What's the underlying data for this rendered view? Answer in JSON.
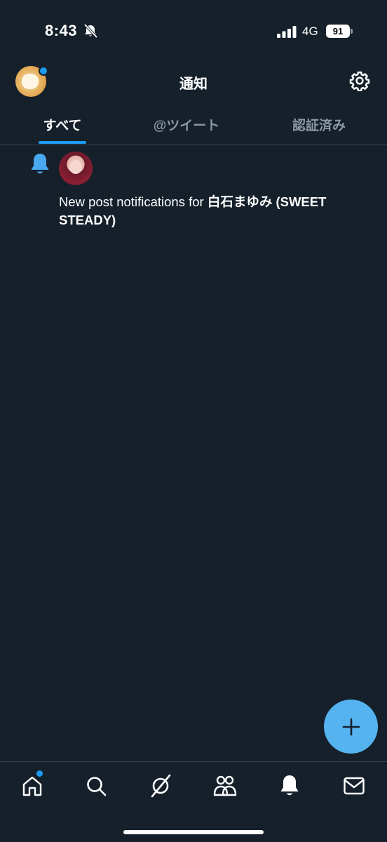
{
  "status_bar": {
    "time": "8:43",
    "network": "4G",
    "battery": "91",
    "icons": [
      "mute-bell-icon",
      "signal-icon",
      "battery-icon"
    ]
  },
  "header": {
    "title": "通知",
    "icons": [
      "profile-avatar",
      "gear-icon"
    ]
  },
  "tabs": {
    "all": "すべて",
    "tweets": "@ツイート",
    "verified": "認証済み",
    "active": "all"
  },
  "notification": {
    "icon": "bell-icon",
    "text_prefix": "New post notifications for ",
    "user_name": "白石まゆみ (SWEET STEADY)"
  },
  "compose": {
    "label": "+",
    "icon": "plus-icon"
  },
  "bottom_nav": {
    "items": [
      "home-icon",
      "search-icon",
      "spaces-icon",
      "communities-icon",
      "bell-icon",
      "mail-icon"
    ],
    "active": "bell-icon"
  },
  "colors": {
    "background": "#15202b",
    "accent": "#1d9bf0",
    "fab": "#55b4f0",
    "muted_text": "#8b98a5",
    "divider": "#38444d"
  }
}
